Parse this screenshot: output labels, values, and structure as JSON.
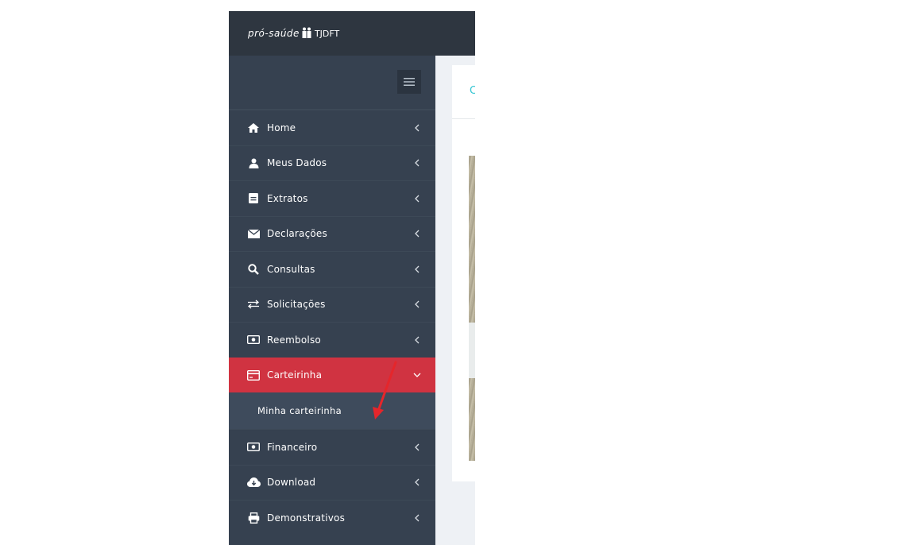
{
  "brand": {
    "logo_text": "pró-saúde",
    "org": "TJDFT"
  },
  "sidebar": {
    "items": [
      {
        "label": "Home",
        "icon": "home-icon"
      },
      {
        "label": "Meus Dados",
        "icon": "user-icon"
      },
      {
        "label": "Extratos",
        "icon": "file-icon"
      },
      {
        "label": "Declarações",
        "icon": "envelope-icon"
      },
      {
        "label": "Consultas",
        "icon": "search-icon"
      },
      {
        "label": "Solicitações",
        "icon": "exchange-icon"
      },
      {
        "label": "Reembolso",
        "icon": "money-icon"
      },
      {
        "label": "Carteirinha",
        "icon": "card-icon",
        "active": true
      },
      {
        "label": "Financeiro",
        "icon": "money-icon"
      },
      {
        "label": "Download",
        "icon": "cloud-download-icon"
      },
      {
        "label": "Demonstrativos",
        "icon": "printer-icon"
      }
    ],
    "submenu": {
      "label": "Minha carteirinha"
    }
  },
  "content": {
    "title_partial": "C"
  },
  "colors": {
    "topbar": "#2e3640",
    "sidebar": "#364150",
    "active": "#d03341",
    "submenu": "#3e4b5c",
    "accent": "#32c5d2",
    "annotation_arrow": "#e5262b"
  }
}
